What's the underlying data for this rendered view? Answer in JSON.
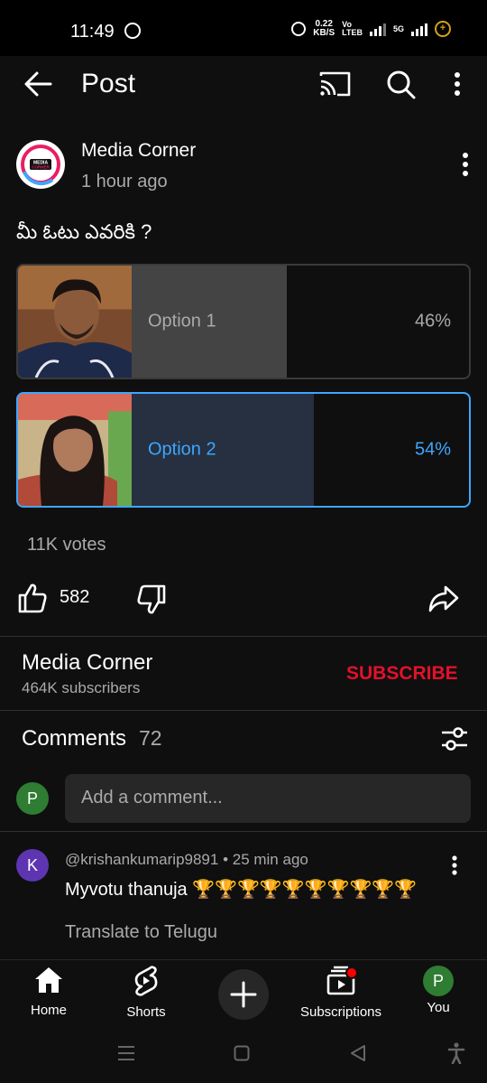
{
  "status_bar": {
    "time": "11:49",
    "speed_value": "0.22",
    "speed_unit": "KB/S",
    "volte": "Vo",
    "lte": "LTEB",
    "network": "5G"
  },
  "app_bar": {
    "title": "Post",
    "icons": [
      "back-arrow-icon",
      "cast-icon",
      "search-icon",
      "more-vertical-icon"
    ]
  },
  "post": {
    "channel_name": "Media Corner",
    "time_ago": "1 hour ago",
    "avatar_logo_text": "MEDIA CORNER",
    "question": "మీ ఓటు ఎవరికి ?",
    "poll": {
      "options": [
        {
          "label": "Option 1",
          "percent_text": "46%",
          "percent": 46,
          "selected": false
        },
        {
          "label": "Option 2",
          "percent_text": "54%",
          "percent": 54,
          "selected": true
        }
      ],
      "votes": "11K votes"
    },
    "likes": "582"
  },
  "channel": {
    "name": "Media Corner",
    "subscribers": "464K subscribers",
    "subscribe_label": "SUBSCRIBE"
  },
  "comments": {
    "label": "Comments",
    "count": "72",
    "user_avatar_letter": "P",
    "placeholder": "Add a comment...",
    "items": [
      {
        "avatar_letter": "K",
        "meta": "@krishankumarip9891 • 25 min ago",
        "text": "Myvotu thanuja 🏆🏆🏆🏆🏆🏆🏆🏆🏆🏆",
        "translate_label": "Translate to Telugu"
      }
    ]
  },
  "bottom_nav": {
    "home": "Home",
    "shorts": "Shorts",
    "subscriptions": "Subscriptions",
    "you": "You",
    "you_avatar_letter": "P"
  },
  "colors": {
    "background": "#0f0f0f",
    "accent_blue": "#3ea6ff",
    "subscribe_red": "#e3112a",
    "notification_red": "#ff0000"
  }
}
